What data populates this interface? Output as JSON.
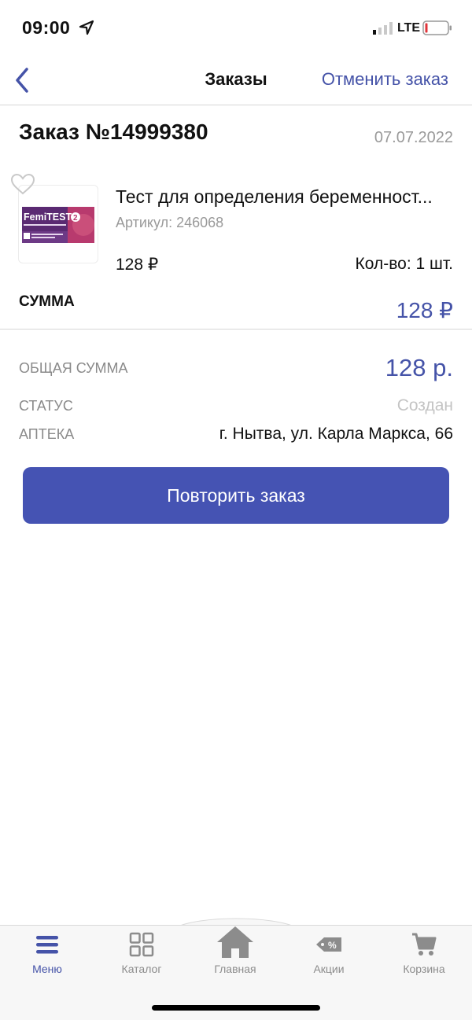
{
  "status_bar": {
    "time": "09:00",
    "network": "LTE",
    "icons": [
      "location-arrow-icon",
      "signal-icon",
      "battery-icon"
    ]
  },
  "nav": {
    "title": "Заказы",
    "action": "Отменить заказ",
    "back_icon": "chevron-left-icon"
  },
  "order": {
    "number": "Заказ №14999380",
    "date": "07.07.2022"
  },
  "product": {
    "name": "Тест для определения беременност...",
    "sku": "Артикул: 246068",
    "price": "128 ₽",
    "qty": "Кол-во: 1 шт.",
    "image_label": "FemiTEST",
    "image_badge": "2",
    "image_icon": "product-box-image"
  },
  "subtotal": {
    "label": "СУММА",
    "value": "128 ₽"
  },
  "summary": {
    "total_label": "ОБЩАЯ СУММА",
    "total_value": "128 р.",
    "status_label": "СТАТУС",
    "status_value": "Создан",
    "pharmacy_label": "АПТЕКА",
    "pharmacy_value": "г. Нытва, ул. Карла Маркса, 66"
  },
  "repeat_button": "Повторить заказ",
  "tabs": [
    {
      "label": "Меню",
      "icon": "hamburger-icon",
      "active": true
    },
    {
      "label": "Каталог",
      "icon": "grid-icon",
      "active": false
    },
    {
      "label": "Главная",
      "icon": "home-icon",
      "active": false
    },
    {
      "label": "Акции",
      "icon": "discount-tag-icon",
      "active": false
    },
    {
      "label": "Корзина",
      "icon": "cart-icon",
      "active": false
    }
  ],
  "colors": {
    "accent": "#4553a8",
    "button": "#4553b3",
    "muted": "#9a9a9a"
  }
}
